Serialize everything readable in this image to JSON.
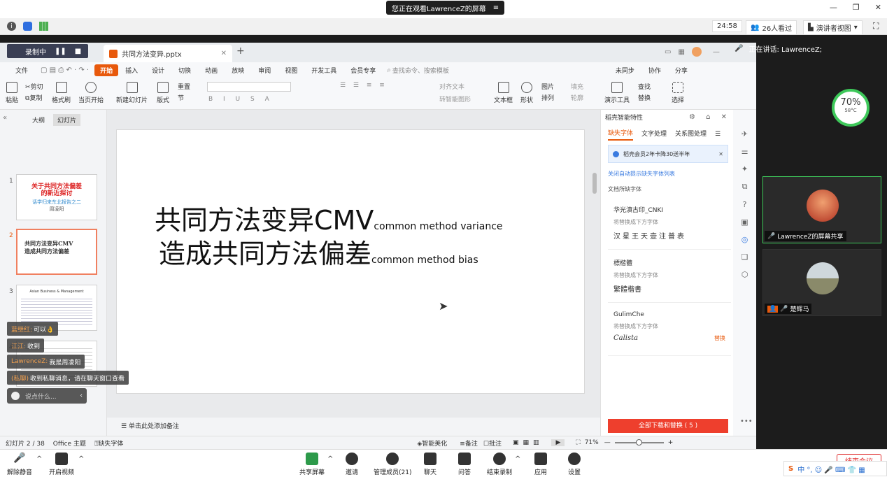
{
  "top": {
    "banner": "您正在观看LawrenceZ的屏幕",
    "banner_menu": "≡"
  },
  "info": {
    "time": "24:58",
    "viewers": "26人看过",
    "view_mode": "演讲者视图"
  },
  "speaker": {
    "label": "正在讲话: LawrenceZ;"
  },
  "recording": {
    "label": "录制中"
  },
  "wps": {
    "tab_title": "共同方法变异.pptx",
    "menu": [
      "文件",
      "开始",
      "插入",
      "设计",
      "切换",
      "动画",
      "放映",
      "审阅",
      "视图",
      "开发工具",
      "会员专享"
    ],
    "search_placeholder": "查找命令、搜索模板",
    "right_menu": [
      "未同步",
      "协作",
      "分享"
    ],
    "ribbon": {
      "paste": "粘贴",
      "cut": "剪切",
      "copy": "复制",
      "format_painter": "格式刷",
      "play_from_current": "当页开始",
      "new_slide": "新建幻灯片",
      "layout": "版式",
      "section": "节",
      "reset": "重置",
      "textbox": "文本框",
      "shape": "形状",
      "arrange": "排列",
      "picture": "图片",
      "fill": "填充",
      "outline": "轮廓",
      "present_tool": "演示工具",
      "find": "查找",
      "replace": "替换",
      "select": "选择",
      "align_text": "对齐文本",
      "convert_smartart": "转智能图形"
    },
    "pane_tabs": [
      "大纲",
      "幻灯片"
    ],
    "thumbs": [
      {
        "num": "1",
        "title": "关于共同方法偏差的新近探讨",
        "sub": "话学归来东北报告之二",
        "author": "周凌阳"
      },
      {
        "num": "2",
        "line1": "共同方法变异CMV",
        "line2": "造成共同方法偏差"
      },
      {
        "num": "3",
        "title": "Asian Business & Management"
      },
      {
        "num": "4"
      },
      {
        "num": "5"
      },
      {
        "num": "6"
      }
    ],
    "slide": {
      "line1_cn": "共同方法变异CMV",
      "line1_en": "common method variance",
      "line2_cn": "造成共同方法偏差",
      "line2_en": "common method bias"
    },
    "notes_placeholder": "单击此处添加备注",
    "status": {
      "slide_pos": "幻灯片 2 / 38",
      "theme": "Office 主题",
      "missing_font": "缺失字体",
      "beautify": "智能美化",
      "notes": "备注",
      "annotation": "批注",
      "zoom": "71%"
    }
  },
  "panel": {
    "title": "稻壳智能特性",
    "tabs": [
      "缺失字体",
      "文字处理",
      "关系图处理"
    ],
    "promo": "稻壳会员2年卡降30送半年",
    "disable_link": "关闭自动提示缺失字体列表",
    "section": "文档所缺字体",
    "fonts": [
      {
        "name": "华光滇古印_CNKI",
        "sub": "将替换成下方字体",
        "sample": "汉星王天壶注普表",
        "action": ""
      },
      {
        "name": "標楷體",
        "sub": "将替换成下方字体",
        "sample": "繁體楷書",
        "action": ""
      },
      {
        "name": "GulimChe",
        "sub": "将替换成下方字体",
        "sample": "Calista",
        "action": "替换"
      }
    ],
    "download_btn": "全部下载和替换 ( 5 )"
  },
  "chats": [
    {
      "name": "蓝继红:",
      "msg": "可以👌"
    },
    {
      "name": "江江:",
      "msg": "收到"
    },
    {
      "name": "LawrenceZ:",
      "msg": "我是周凌阳"
    },
    {
      "name": "(私聊)",
      "msg": "收到私聊消息，请在聊天窗口查看"
    }
  ],
  "chat_input": "说点什么...",
  "cpu": {
    "pct": "70%",
    "temp": "58°C"
  },
  "videos": [
    {
      "label": "LawrenceZ的屏幕共享"
    },
    {
      "label": "楚辉马"
    }
  ],
  "bottom": {
    "mute": "解除静音",
    "video": "开启视频",
    "share": "共享屏幕",
    "invite": "邀请",
    "members": "管理成员(21)",
    "chat": "聊天",
    "qa": "问答",
    "end_rec": "结束录制",
    "apps": "应用",
    "settings": "设置",
    "end_meeting": "结束会议"
  },
  "colors": {
    "accent": "#e8590c",
    "red_btn": "#ee3f2d",
    "green_ring": "#3ec85a"
  }
}
